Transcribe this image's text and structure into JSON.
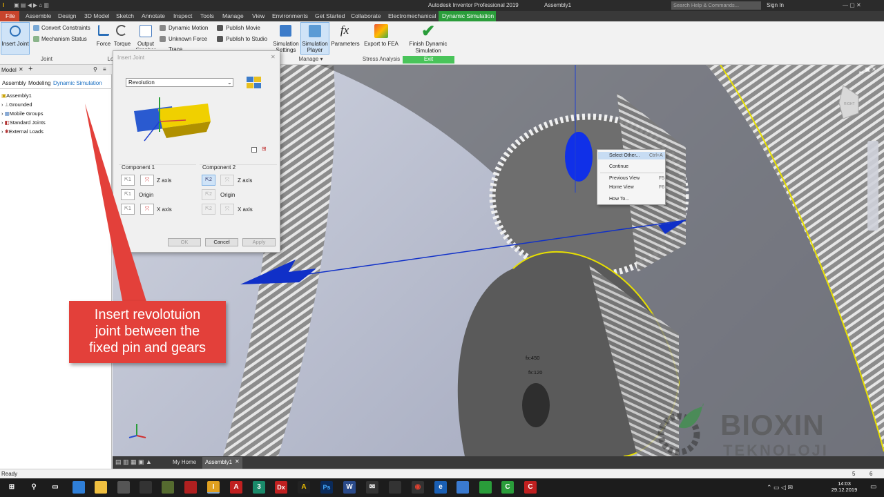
{
  "titlebar": {
    "app_title": "Autodesk Inventor Professional 2019",
    "doc_title": "Assembly1",
    "search_placeholder": "Search Help & Commands...",
    "sign_in": "Sign In"
  },
  "tabs": [
    "File",
    "Assemble",
    "Design",
    "3D Model",
    "Sketch",
    "Annotate",
    "Inspect",
    "Tools",
    "Manage",
    "View",
    "Environments",
    "Get Started",
    "Collaborate",
    "Electromechanical",
    "Dynamic Simulation"
  ],
  "ribbon": {
    "insert_joint": "Insert Joint",
    "convert_constraints": "Convert Constraints",
    "mechanism_status": "Mechanism Status",
    "joint_group": "Joint",
    "force": "Force",
    "torque": "Torque",
    "output_grapher": "Output Grapher",
    "dynamic_motion": "Dynamic Motion",
    "unknown_force": "Unknown Force",
    "trace": "Trace",
    "publish_movie": "Publish Movie",
    "publish_studio": "Publish to Studio",
    "simulation_settings": "Simulation Settings",
    "simulation_player": "Simulation Player",
    "parameters": "Parameters",
    "manage_group": "Manage",
    "export_fea": "Export to FEA",
    "stress_group": "Stress Analysis",
    "finish": "Finish Dynamic Simulation",
    "exit_group": "Exit",
    "lo_group": "Lo"
  },
  "panel": {
    "tab_model": "Model",
    "subtabs": [
      "Assembly",
      "Modeling",
      "Dynamic Simulation"
    ],
    "tree": [
      "Assembly1",
      "Grounded",
      "Mobile Groups",
      "Standard Joints",
      "External Loads"
    ]
  },
  "dialog": {
    "title": "Insert Joint",
    "joint_type": "Revolution",
    "comp1": "Component 1",
    "comp2": "Component 2",
    "z_axis": "Z axis",
    "origin": "Origin",
    "x_axis": "X axis",
    "ok": "OK",
    "cancel": "Cancel",
    "apply": "Apply"
  },
  "context_menu": [
    {
      "label": "Select Other...",
      "key": "Ctrl+A"
    },
    {
      "label": "Continue",
      "key": ""
    },
    {
      "label": "Previous View",
      "key": "F5"
    },
    {
      "label": "Home View",
      "key": "F6"
    },
    {
      "label": "How To...",
      "key": ""
    }
  ],
  "callout": {
    "line1": "Insert revolotuion",
    "line2": "joint between the",
    "line3": "fixed pin and gears"
  },
  "viewport": {
    "label_fx450": "fx:450",
    "label_fx120": "fx:120",
    "watermark1": "BIOXIN",
    "watermark2": "TEKNOLOJI",
    "viewcube": "RIGHT"
  },
  "doctabs": {
    "home": "My Home",
    "doc": "Assembly1"
  },
  "status": {
    "ready": "Ready",
    "n1": "5",
    "n2": "6"
  },
  "clock": {
    "time": "14:03",
    "date": "29.12.2019"
  },
  "colors": {
    "accent_green": "#2a9d3a",
    "callout": "#e3403a",
    "joint_blue": "#1030c8"
  }
}
